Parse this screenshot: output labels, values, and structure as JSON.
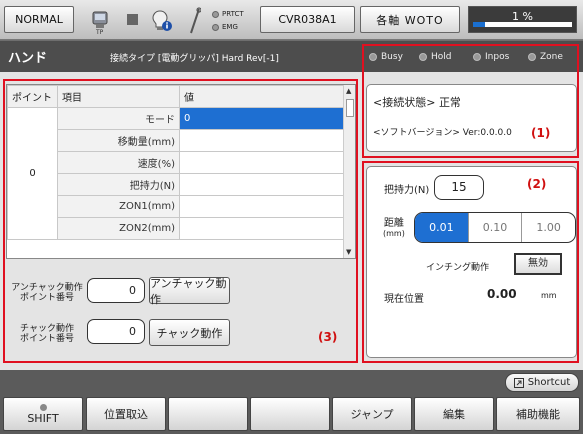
{
  "topbar": {
    "mode_label": "NORMAL",
    "tp_label": "TP",
    "prtct_label": "PRTCT",
    "emg_label": "EMG",
    "controller_label": "CVR038A1",
    "axis_label": "各軸 WOTO",
    "speed_label": "1 %",
    "speed_fraction": 0.12
  },
  "title": {
    "main": "ハンド",
    "connection": "接続タイプ [電動グリッパ] Hard Rev[-1]"
  },
  "status": [
    "Busy",
    "Hold",
    "Inpos",
    "Zone"
  ],
  "table": {
    "headers": [
      "ポイント",
      "項目",
      "値"
    ],
    "point_value": "0",
    "rows": [
      {
        "field": "モード",
        "value": "0"
      },
      {
        "field": "移動量(mm)",
        "value": ""
      },
      {
        "field": "速度(%)",
        "value": ""
      },
      {
        "field": "把持力(N)",
        "value": ""
      },
      {
        "field": "ZON1(mm)",
        "value": ""
      },
      {
        "field": "ZON2(mm)",
        "value": ""
      }
    ]
  },
  "operations": {
    "unchuck_label_line1": "アンチャック動作",
    "unchuck_label_line2": "ポイント番号",
    "unchuck_value": "0",
    "unchuck_button": "アンチャック動作",
    "chuck_label_line1": "チャック動作",
    "chuck_label_line2": "ポイント番号",
    "chuck_value": "0",
    "chuck_button": "チャック動作"
  },
  "info": {
    "state_label": "<接続状態>",
    "state_value": "正常",
    "version_label": "<ソフトバージョン>",
    "version_value": "Ver:0.0.0.0"
  },
  "jog": {
    "force_label": "把持力(N)",
    "force_value": "15",
    "distance_label_1": "距離",
    "distance_label_2": "(mm)",
    "distances": [
      "0.01",
      "0.10",
      "1.00"
    ],
    "inching_label": "インチング動作",
    "inching_value": "無効",
    "position_label": "現在位置",
    "position_value": "0.00",
    "position_unit": "mm"
  },
  "annotations": [
    "(1)",
    "(2)",
    "(3)"
  ],
  "footer": {
    "shortcut_label": "Shortcut",
    "keys": [
      "SHIFT",
      "位置取込",
      "",
      "",
      "ジャンプ",
      "編集",
      "補助機能"
    ]
  },
  "colors": {
    "accent": "#1e6fd2",
    "annotation": "#e01020",
    "titlebar": "#4d4d4d"
  }
}
